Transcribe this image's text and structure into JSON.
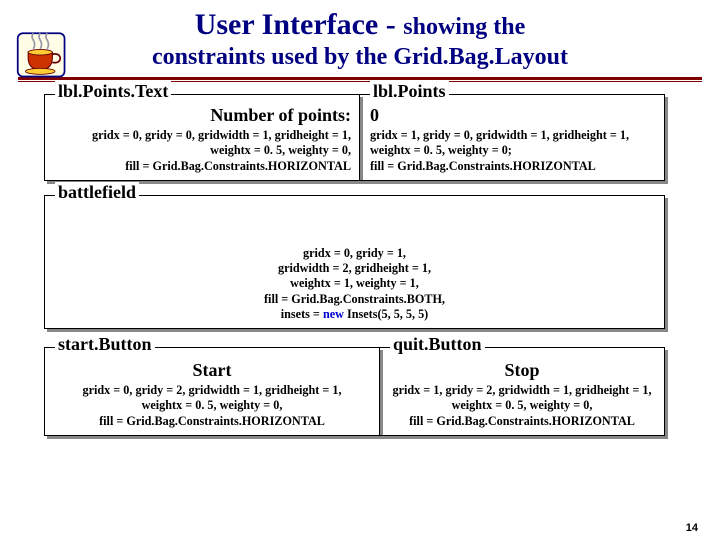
{
  "header": {
    "title_main": "User Interface - ",
    "title_sub": "showing the",
    "title_line2": "constraints used by the Grid.Bag.Layout"
  },
  "groups": {
    "lblPointsText": {
      "legend": "lbl.Points.Text",
      "value": "Number of points:",
      "c1": "gridx  = 0, gridy = 0, gridwidth = 1, gridheight = 1,",
      "c2": "weightx = 0. 5, weighty = 0,",
      "c3": "fill  = Grid.Bag.Constraints.HORIZONTAL"
    },
    "lblPoints": {
      "legend": "lbl.Points",
      "value": "0",
      "c1": "gridx  = 1, gridy = 0,  gridwidth = 1, gridheight = 1,",
      "c2": "weightx   = 0. 5, weighty    = 0;",
      "c3": "fill = Grid.Bag.Constraints.HORIZONTAL"
    },
    "battlefield": {
      "legend": "battlefield",
      "c1": "gridx = 0, gridy = 1,",
      "c2": "gridwidth = 2, gridheight = 1,",
      "c3": "weightx = 1,  weighty = 1,",
      "c4": "fill  = Grid.Bag.Constraints.BOTH,",
      "c5_pre": "insets = ",
      "c5_kw": "new",
      "c5_post": " Insets(5, 5, 5, 5)"
    },
    "startButton": {
      "legend": "start.Button",
      "value": "Start",
      "c1": "gridx = 0, gridy = 2, gridwidth = 1, gridheight = 1,",
      "c2": "weightx  = 0. 5, weighty = 0,",
      "c3": "fill = Grid.Bag.Constraints.HORIZONTAL"
    },
    "quitButton": {
      "legend": "quit.Button",
      "value": "Stop",
      "c1": "gridx = 1, gridy = 2, gridwidth = 1, gridheight = 1,",
      "c2": "weightx = 0. 5, weighty = 0,",
      "c3": "fill = Grid.Bag.Constraints.HORIZONTAL"
    }
  },
  "page_number": "14"
}
